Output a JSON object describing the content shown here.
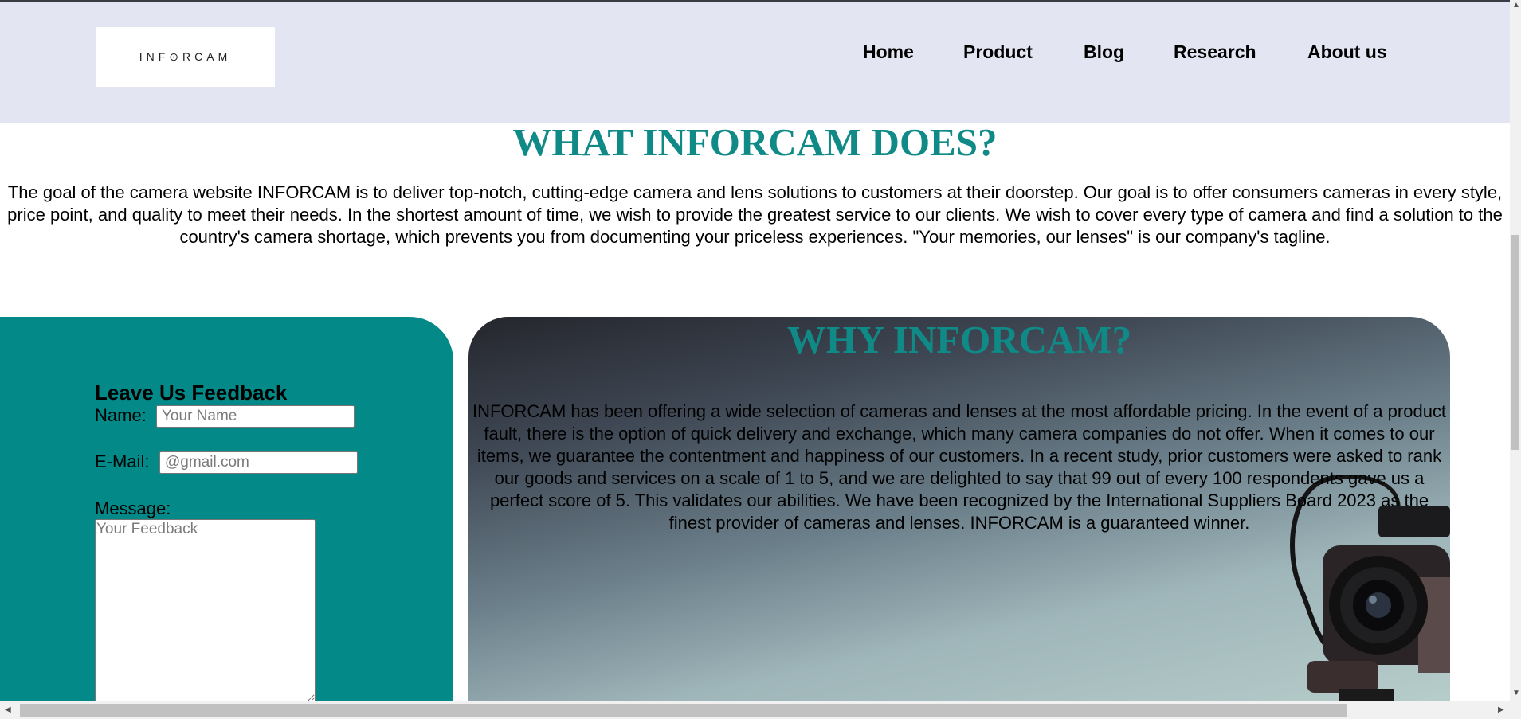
{
  "header": {
    "logo_text": "INF⊙RCAM",
    "nav": [
      "Home",
      "Product",
      "Blog",
      "Research",
      "About us"
    ]
  },
  "what_section": {
    "title": "WHAT INFORCAM DOES?",
    "body": "The goal of the camera website INFORCAM is to deliver top-notch, cutting-edge camera and lens solutions to customers at their doorstep. Our goal is to offer consumers cameras in every style, price point, and quality to meet their needs. In the shortest amount of time, we wish to provide the greatest service to our clients. We wish to cover every type of camera and find a solution to the country's camera shortage, which prevents you from documenting your priceless experiences. \"Your memories, our lenses\" is our company's tagline."
  },
  "feedback": {
    "title": "Leave Us Feedback",
    "name_label": "Name:",
    "name_placeholder": "Your Name",
    "email_label": "E-Mail:",
    "email_placeholder": "@gmail.com",
    "message_label": "Message:",
    "message_placeholder": "Your Feedback"
  },
  "why_section": {
    "title": "WHY INFORCAM?",
    "body": "INFORCAM has been offering a wide selection of cameras and lenses at the most affordable pricing. In the event of a product fault, there is the option of quick delivery and exchange, which many camera companies do not offer. When it comes to our items, we guarantee the contentment and happiness of our customers. In a recent study, prior customers were asked to rank our goods and services on a scale of 1 to 5, and we are delighted to say that 99 out of every 100 respondents gave us a perfect score of 5. This validates our abilities. We have been recognized by the International Suppliers Board 2023 as the finest provider of cameras and lenses. INFORCAM is a guaranteed winner."
  },
  "colors": {
    "header_bg": "#e3e6f2",
    "accent_teal": "#0f8a87",
    "feedback_bg": "#038a88"
  },
  "icons": [
    "camera-image",
    "scroll-arrow-up-icon",
    "scroll-arrow-down-icon",
    "scroll-arrow-left-icon",
    "scroll-arrow-right-icon"
  ]
}
